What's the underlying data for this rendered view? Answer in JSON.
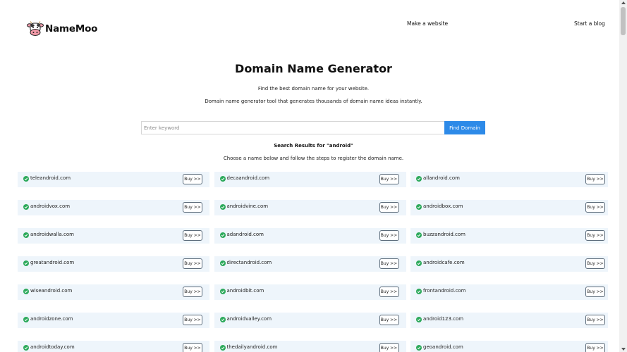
{
  "brand": {
    "name": "NameMoo",
    "logo_icon": "cow-icon"
  },
  "nav": {
    "make_website": "Make a website",
    "start_blog": "Start a blog"
  },
  "hero": {
    "title": "Domain Name Generator",
    "subtitle1": "Find the best domain name for your website.",
    "subtitle2": "Domain name generator tool that generates thousands of domain name ideas instantly."
  },
  "search": {
    "placeholder": "Enter keyword",
    "value": "",
    "button_label": "Find Domain"
  },
  "results": {
    "title": "Search Results for \"android\"",
    "subtitle": "Choose a name below and follow the steps to register the domain name.",
    "buy_label": "Buy >>",
    "status_icon": "check-circle-icon",
    "colors": {
      "card_bg": "#eef5fb",
      "check": "#2eaa5c",
      "accent": "#2d8ae8"
    },
    "domains": [
      "teleandroid.com",
      "decaandroid.com",
      "allandroid.com",
      "androidvox.com",
      "androidvine.com",
      "androidbox.com",
      "androidwalla.com",
      "adandroid.com",
      "buzzandroid.com",
      "greatandroid.com",
      "directandroid.com",
      "androidcafe.com",
      "wiseandroid.com",
      "androidbit.com",
      "frontandroid.com",
      "androidzone.com",
      "androidvalley.com",
      "android123.com",
      "androidtoday.com",
      "thedailyandroid.com",
      "geoandroid.com"
    ]
  }
}
